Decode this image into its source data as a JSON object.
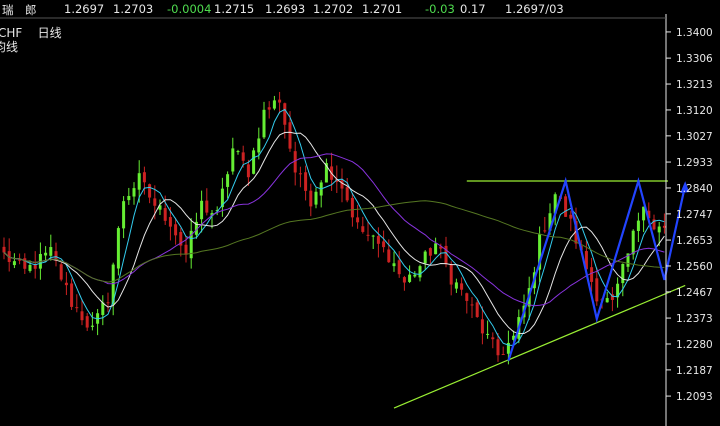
{
  "header": {
    "name": "瑞　郎",
    "values": [
      "1.2697",
      "1.2703",
      "-0.0004",
      "1.2715",
      "1.2693",
      "1.2702",
      "1.2701",
      "-0.03",
      "0.17",
      "1.2697/03"
    ],
    "colors": [
      "#e8e8e8",
      "#e8e8e8",
      "#4fdc4f",
      "#e8e8e8",
      "#e8e8e8",
      "#e8e8e8",
      "#e8e8e8",
      "#4fdc4f",
      "#e8e8e8",
      "#e8e8e8"
    ]
  },
  "labels": {
    "symbol": "CHF",
    "period": "日线",
    "sub": "均线"
  },
  "chart_data": {
    "type": "candlestick",
    "y_ticks": [
      "1.3400",
      "1.3306",
      "1.3213",
      "1.3120",
      "1.3027",
      "1.2933",
      "1.2840",
      "1.2747",
      "1.2653",
      "1.2560",
      "1.2467",
      "1.2373",
      "1.2280",
      "1.2187",
      "1.2093"
    ],
    "ylim": [
      1.2,
      1.345
    ],
    "grid": false,
    "colors": {
      "up": "#66ee33",
      "down": "#cc2222",
      "ma_white": "#e6e6e6",
      "ma_cyan": "#33ccee",
      "ma_purple": "#8833dd",
      "ma_olive": "#557722",
      "trendline": "#99ee33",
      "pattern": "#2244ff",
      "axis": "#e8e8e8"
    },
    "n_candles": 128,
    "anchors": [
      [
        0,
        1.26
      ],
      [
        4,
        1.254
      ],
      [
        9,
        1.261
      ],
      [
        13,
        1.243
      ],
      [
        17,
        1.233
      ],
      [
        20,
        1.245
      ],
      [
        23,
        1.28
      ],
      [
        26,
        1.287
      ],
      [
        29,
        1.278
      ],
      [
        32,
        1.272
      ],
      [
        35,
        1.26
      ],
      [
        38,
        1.278
      ],
      [
        41,
        1.274
      ],
      [
        44,
        1.298
      ],
      [
        47,
        1.29
      ],
      [
        50,
        1.311
      ],
      [
        53,
        1.316
      ],
      [
        56,
        1.29
      ],
      [
        59,
        1.28
      ],
      [
        62,
        1.292
      ],
      [
        65,
        1.285
      ],
      [
        68,
        1.27
      ],
      [
        71,
        1.265
      ],
      [
        74,
        1.26
      ],
      [
        77,
        1.25
      ],
      [
        80,
        1.256
      ],
      [
        83,
        1.264
      ],
      [
        86,
        1.252
      ],
      [
        89,
        1.244
      ],
      [
        92,
        1.233
      ],
      [
        95,
        1.224
      ],
      [
        98,
        1.23
      ],
      [
        101,
        1.247
      ],
      [
        103,
        1.265
      ],
      [
        106,
        1.282
      ],
      [
        109,
        1.271
      ],
      [
        111,
        1.26
      ],
      [
        114,
        1.246
      ],
      [
        117,
        1.242
      ],
      [
        120,
        1.26
      ],
      [
        123,
        1.28
      ],
      [
        125,
        1.269
      ],
      [
        127,
        1.2697
      ]
    ],
    "trend_support": [
      [
        1.205,
        75
      ],
      [
        1.249,
        131
      ]
    ],
    "resistance": 1.2865,
    "pattern": [
      [
        97,
        1.222
      ],
      [
        108,
        1.2865
      ],
      [
        114,
        1.237
      ],
      [
        122,
        1.2865
      ],
      [
        127,
        1.251
      ],
      [
        131,
        1.285
      ]
    ]
  }
}
